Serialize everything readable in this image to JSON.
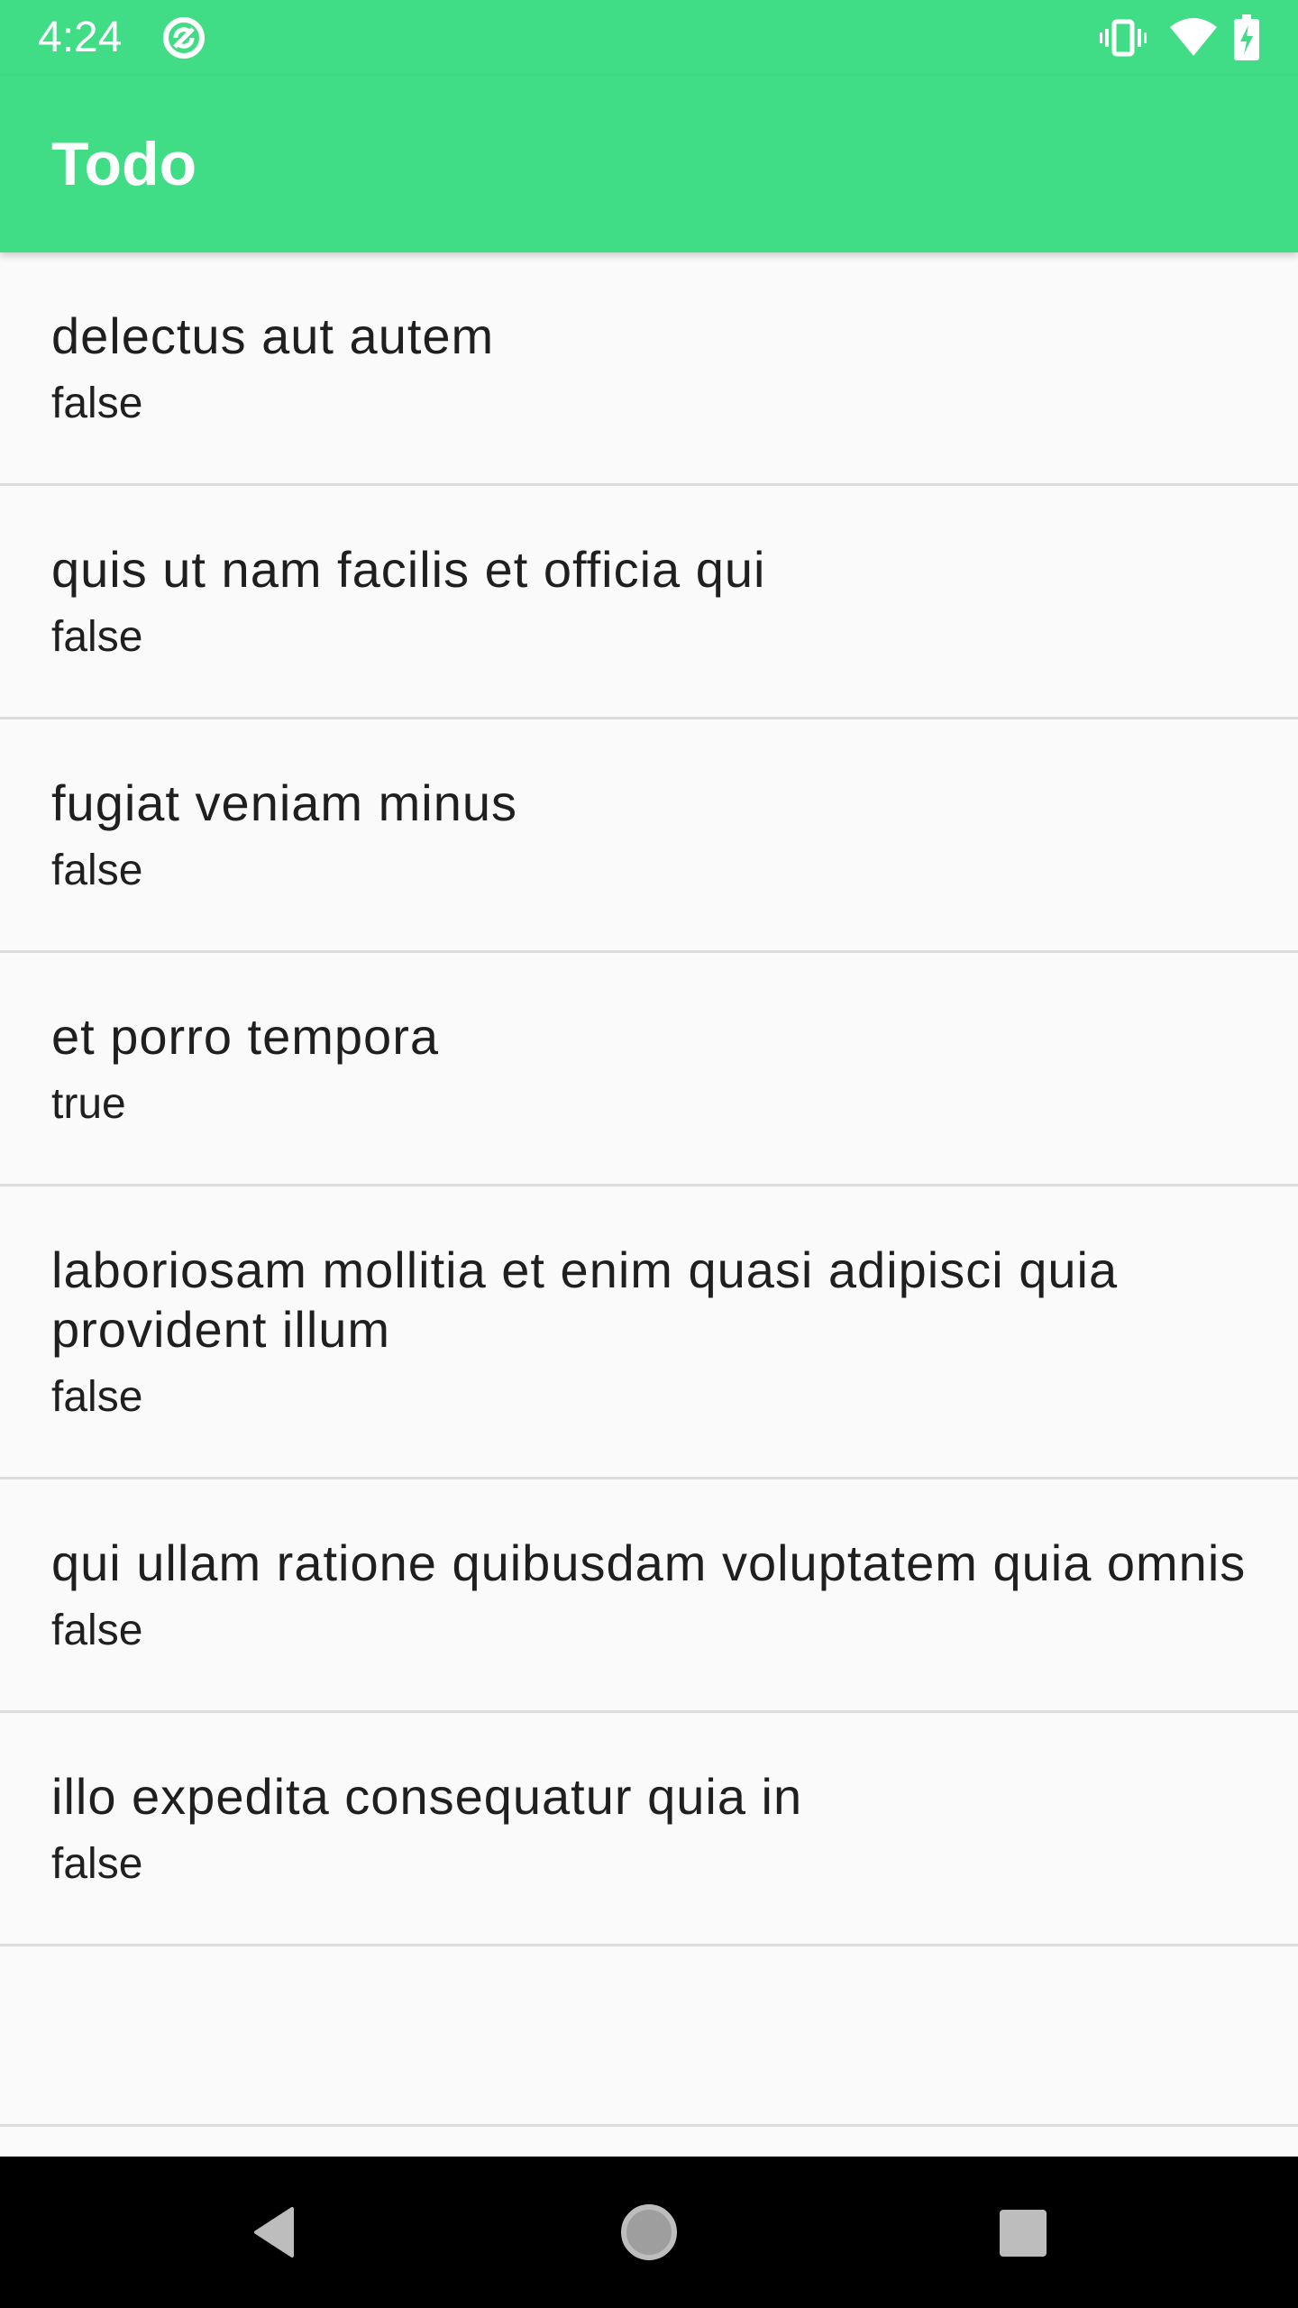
{
  "status_bar": {
    "time": "4:24",
    "icons": [
      "sync-icon",
      "vibrate-icon",
      "wifi-icon",
      "battery-charging-icon"
    ]
  },
  "app_bar": {
    "title": "Todo"
  },
  "todos": [
    {
      "title": "delectus aut autem",
      "completed": "false"
    },
    {
      "title": "quis ut nam facilis et officia qui",
      "completed": "false"
    },
    {
      "title": "fugiat veniam minus",
      "completed": "false"
    },
    {
      "title": "et porro tempora",
      "completed": "true"
    },
    {
      "title": "laboriosam mollitia et enim quasi adipisci quia provident illum",
      "completed": "false"
    },
    {
      "title": "qui ullam ratione quibusdam voluptatem quia omnis",
      "completed": "false"
    },
    {
      "title": "illo expedita consequatur quia in",
      "completed": "false"
    }
  ],
  "nav_bar": {
    "buttons": [
      "back-icon",
      "home-icon",
      "recents-icon"
    ]
  },
  "colors": {
    "accent": "#41dd86",
    "background": "#fafafa",
    "divider": "#dcdcdc",
    "nav_bar": "#000000"
  }
}
